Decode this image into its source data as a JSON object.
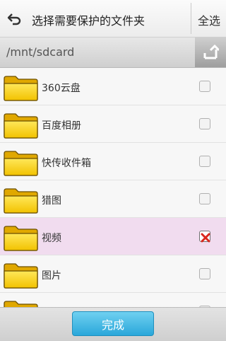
{
  "header": {
    "title": "选择需要保护的文件夹",
    "select_all_label": "全选"
  },
  "path": {
    "current": "/mnt/sdcard"
  },
  "items": [
    {
      "label": "360云盘",
      "checked": false
    },
    {
      "label": "百度相册",
      "checked": false
    },
    {
      "label": "快传收件箱",
      "checked": false
    },
    {
      "label": "猎图",
      "checked": false
    },
    {
      "label": "视频",
      "checked": true
    },
    {
      "label": "图片",
      "checked": false
    },
    {
      "label": "",
      "checked": false
    }
  ],
  "footer": {
    "done_label": "完成"
  },
  "colors": {
    "selected_row": "#f1dcef",
    "done_button": "#2aa7da",
    "folder_yellow": "#f5c400",
    "checkmark_red": "#d9261c"
  },
  "icons": {
    "back": "back-arrow-icon",
    "up": "up-directory-icon",
    "folder": "folder-icon",
    "check": "red-x-check-icon"
  }
}
